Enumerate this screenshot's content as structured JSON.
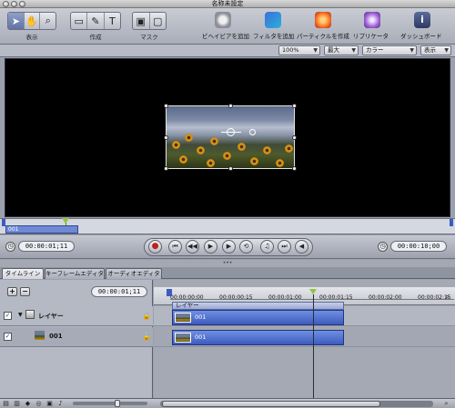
{
  "window": {
    "title": "名称未設定"
  },
  "toolbar": {
    "groups": [
      {
        "label": "表示",
        "tools": [
          "arrow-tool",
          "hand-tool",
          "zoom-tool"
        ]
      },
      {
        "label": "作成",
        "tools": [
          "rectangle-tool",
          "bezier-tool",
          "text-tool"
        ]
      },
      {
        "label": "マスク",
        "tools": [
          "mask-rect-tool",
          "mask-bezier-tool"
        ]
      }
    ],
    "actions": {
      "add_behavior": "ビヘイビアを追加",
      "add_filter": "フィルタを追加",
      "make_particles": "パーティクルを作成",
      "replicator": "リプリケータ",
      "dashboard": "ダッシュボード"
    }
  },
  "canvas_options": {
    "zoom": "100%",
    "resolution": "最大",
    "channels": "カラー",
    "view": "表示"
  },
  "mini_timeline": {
    "clip_label": "001"
  },
  "transport": {
    "current_time": "00:00:01;11",
    "end_time": "00:00:10;00",
    "buttons": [
      "record",
      "go-to-start",
      "play-from-start",
      "play-pause",
      "loop",
      "audio",
      "go-to-end",
      "previous-frame",
      "next-frame"
    ]
  },
  "tabs": [
    {
      "label": "タイムライン",
      "active": true
    },
    {
      "label": "キーフレームエディタ",
      "active": false
    },
    {
      "label": "オーディオエディタ",
      "active": false
    }
  ],
  "timeline": {
    "add_label": "+",
    "remove_label": "−",
    "timecode": "00:00:01;11",
    "ruler": [
      "00:00:00:00",
      "00:00:00:15",
      "00:00:01:00",
      "00:00:01:15",
      "00:00:02:00",
      "00:00:02:15"
    ],
    "layers": [
      {
        "name": "レイヤー",
        "checked": true
      },
      {
        "name": "001",
        "checked": true
      }
    ],
    "group_clip_label": "レイヤー",
    "clips": [
      "001",
      "001"
    ]
  },
  "colors": {
    "accent": "#3d5bbf",
    "playhead": "#8ec63f"
  }
}
